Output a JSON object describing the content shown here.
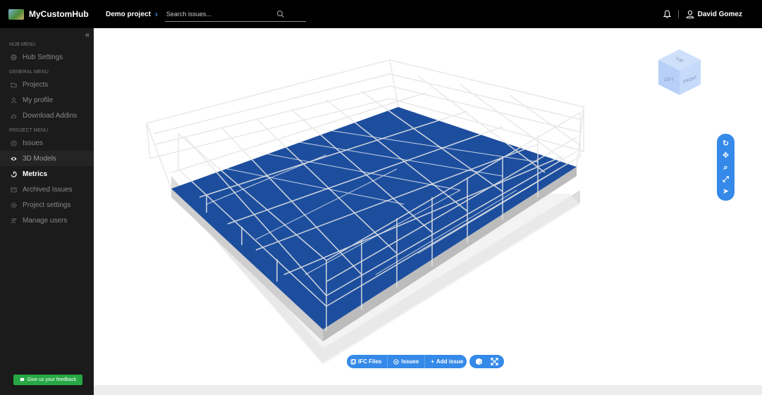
{
  "app": {
    "name": "MyCustomHub"
  },
  "topbar": {
    "project": "Demo project",
    "search_placeholder": "Search issues...",
    "user_name": "David Gomez"
  },
  "sidebar": {
    "hub_menu_title": "HUB MENU",
    "hub_items": [
      {
        "label": "Hub Settings",
        "icon": "globe-icon"
      }
    ],
    "general_menu_title": "GENERAL MENU",
    "general_items": [
      {
        "label": "Projects",
        "icon": "folder-icon"
      },
      {
        "label": "My profile",
        "icon": "user-icon"
      },
      {
        "label": "Download Addins",
        "icon": "cloud-icon"
      }
    ],
    "project_menu_title": "PROJECT MENU",
    "project_items": [
      {
        "label": "Issues",
        "icon": "issues-icon"
      },
      {
        "label": "3D Models",
        "icon": "eye-icon",
        "state": "active"
      },
      {
        "label": "Metrics",
        "icon": "metrics-icon",
        "state": "highlighted"
      },
      {
        "label": "Archived Issues",
        "icon": "archive-icon"
      },
      {
        "label": "Project settings",
        "icon": "gear-icon"
      },
      {
        "label": "Manage users",
        "icon": "users-icon"
      }
    ],
    "feedback_label": "Give us your feedback"
  },
  "viewer": {
    "navcube": {
      "top": "TOP",
      "left": "LEFT",
      "front": "FRONT"
    },
    "side_tools": [
      "rotate-icon",
      "pan-icon",
      "zoom-icon",
      "fit-icon",
      "select-icon"
    ],
    "toolbar": {
      "ifc_label": "IFC Files",
      "issues_label": "Issues",
      "add_issue_label": "Add issue"
    },
    "colors": {
      "floor": "#1d4e9e",
      "frame": "#e3e3e3",
      "accent": "#3589e8"
    }
  }
}
